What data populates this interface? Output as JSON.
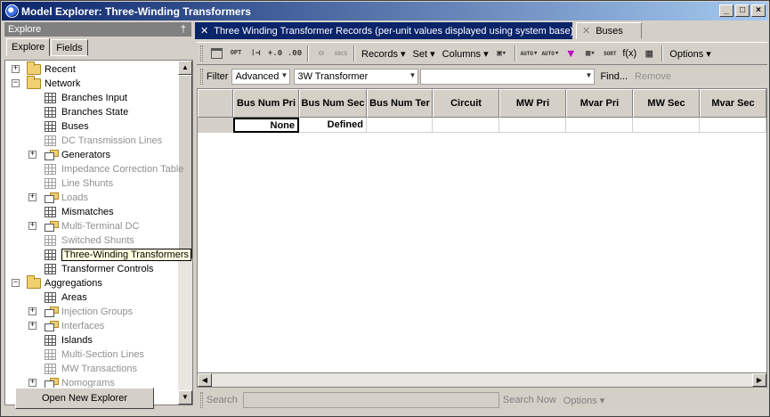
{
  "window": {
    "title": "Model Explorer: Three-Winding Transformers"
  },
  "explore_panel": {
    "header": "Explore",
    "pin_glyph": "†",
    "tabs": [
      {
        "label": "Explore"
      },
      {
        "label": "Fields"
      }
    ],
    "tree": [
      {
        "label": "Recent",
        "kind": "folder",
        "expander": "+",
        "dim": false
      },
      {
        "label": "Network",
        "kind": "folder",
        "expander": "−",
        "dim": false
      },
      {
        "label": "Branches Input",
        "kind": "grid",
        "dim": false
      },
      {
        "label": "Branches State",
        "kind": "grid",
        "dim": false
      },
      {
        "label": "Buses",
        "kind": "grid",
        "dim": false
      },
      {
        "label": "DC Transmission Lines",
        "kind": "grid",
        "dim": true
      },
      {
        "label": "Generators",
        "kind": "gridfolder",
        "expander": "+",
        "dim": false
      },
      {
        "label": "Impedance Correction Table",
        "kind": "grid",
        "dim": true
      },
      {
        "label": "Line Shunts",
        "kind": "grid",
        "dim": true
      },
      {
        "label": "Loads",
        "kind": "gridfolder",
        "expander": "+",
        "dim": true
      },
      {
        "label": "Mismatches",
        "kind": "grid",
        "dim": false
      },
      {
        "label": "Multi-Terminal DC",
        "kind": "gridfolder",
        "expander": "+",
        "dim": true
      },
      {
        "label": "Switched Shunts",
        "kind": "grid",
        "dim": true
      },
      {
        "label": "Three-Winding Transformers",
        "kind": "grid",
        "dim": false,
        "selected": true
      },
      {
        "label": "Transformer Controls",
        "kind": "grid",
        "dim": false
      },
      {
        "label": "Aggregations",
        "kind": "folder",
        "expander": "−",
        "dim": false
      },
      {
        "label": "Areas",
        "kind": "grid",
        "dim": false
      },
      {
        "label": "Injection Groups",
        "kind": "gridfolder",
        "expander": "+",
        "dim": true
      },
      {
        "label": "Interfaces",
        "kind": "gridfolder",
        "expander": "+",
        "dim": true
      },
      {
        "label": "Islands",
        "kind": "grid",
        "dim": false
      },
      {
        "label": "Multi-Section Lines",
        "kind": "grid",
        "dim": true
      },
      {
        "label": "MW Transactions",
        "kind": "grid",
        "dim": true
      },
      {
        "label": "Nomograms",
        "kind": "gridfolder",
        "expander": "+",
        "dim": true
      }
    ],
    "open_new_button": "Open New Explorer"
  },
  "doc_tabs": [
    {
      "label": "Three Winding Transformer Records (per-unit values displayed using system base)",
      "close": "✕"
    },
    {
      "label": "Buses",
      "close": "✕"
    }
  ],
  "toolbar": {
    "records": "Records ▾",
    "set": "Set ▾",
    "columns": "Columns ▾",
    "options": "Options ▾",
    "fx": "f(x)",
    "icons": {
      "opt": "OPT",
      "sort": "SORT",
      "auto1": "AUTO",
      "auto2": "AUTO",
      "find1": "…",
      "find2": "ABCD"
    }
  },
  "filter": {
    "label": "Filter",
    "mode": "Advanced",
    "filter_name": "3W Transformer",
    "find": "Find...",
    "remove": "Remove"
  },
  "table": {
    "columns": [
      "Bus Num Pri",
      "Bus Num Sec",
      "Bus Num Ter",
      "Circuit",
      "MW Pri",
      "Mvar Pri",
      "MW Sec",
      "Mvar Sec"
    ],
    "rows": [
      [
        "None",
        "Defined",
        "",
        "",
        "",
        "",
        "",
        ""
      ]
    ]
  },
  "search": {
    "label": "Search",
    "search_now": "Search Now",
    "options": "Options ▾"
  },
  "colors": {
    "title_gradient_start": "#0a246a",
    "title_gradient_end": "#a6caf0",
    "active_tab": "#0a246a"
  }
}
